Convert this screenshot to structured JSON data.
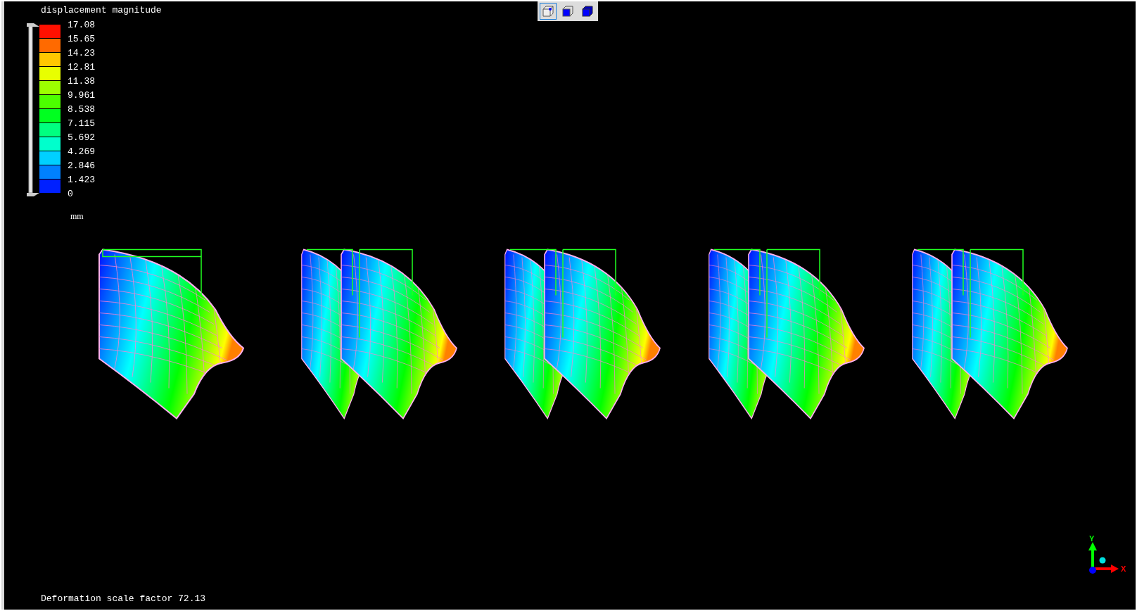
{
  "legend": {
    "title": "displacement magnitude",
    "unit": "mm",
    "labels": [
      "17.08",
      "15.65",
      "14.23",
      "12.81",
      "11.38",
      "9.961",
      "8.538",
      "7.115",
      "5.692",
      "4.269",
      "2.846",
      "1.423",
      "0"
    ],
    "bands": [
      {
        "color": "#ff1000"
      },
      {
        "color": "#ff6a00"
      },
      {
        "color": "#ffc800"
      },
      {
        "color": "#e8ff00"
      },
      {
        "color": "#9cff00"
      },
      {
        "color": "#4cff00"
      },
      {
        "color": "#00ff20"
      },
      {
        "color": "#00ff80"
      },
      {
        "color": "#00ffcc"
      },
      {
        "color": "#00d0ff"
      },
      {
        "color": "#0080ff"
      },
      {
        "color": "#0020ff"
      }
    ]
  },
  "toolbar": {
    "buttons": [
      {
        "kind": "wire",
        "selected": true
      },
      {
        "kind": "front",
        "selected": false
      },
      {
        "kind": "solid",
        "selected": false
      }
    ]
  },
  "models": [
    {
      "kind": "single"
    },
    {
      "kind": "split"
    },
    {
      "kind": "split"
    },
    {
      "kind": "split"
    },
    {
      "kind": "split"
    }
  ],
  "axes": {
    "x_label": "X",
    "y_label": "Y"
  },
  "footer": "Deformation scale factor 72.13"
}
